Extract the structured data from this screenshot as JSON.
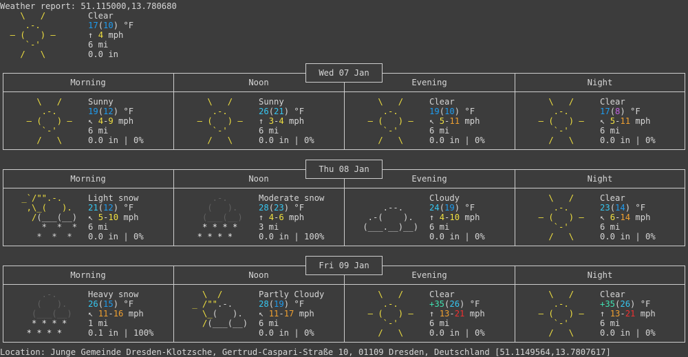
{
  "header": {
    "title": "Weather report: 51.115000,13.780680"
  },
  "current": {
    "condition": "Clear",
    "temp": "17",
    "feels": "10",
    "temp_unit": "°F",
    "wind_arrow": "↑",
    "wind": "4",
    "wind_unit": "mph",
    "visibility": "6 mi",
    "precip": "0.0 in"
  },
  "period_labels": [
    "Morning",
    "Noon",
    "Evening",
    "Night"
  ],
  "days": [
    {
      "date": "Wed 07 Jan",
      "periods": [
        {
          "art": "sunny",
          "condition": "Sunny",
          "temp": "19",
          "feels": "12",
          "wind_arrow": "↖",
          "wind": "4-9",
          "visibility": "6 mi",
          "precip": "0.0 in | 0%"
        },
        {
          "art": "sunny",
          "condition": "Sunny",
          "temp": "26",
          "feels": "21",
          "wind_arrow": "↑",
          "wind": "3-4",
          "visibility": "6 mi",
          "precip": "0.0 in | 0%"
        },
        {
          "art": "sunny",
          "condition": "Clear",
          "temp": "19",
          "feels": "10",
          "wind_arrow": "↖",
          "wind": "5-11",
          "visibility": "6 mi",
          "precip": "0.0 in | 0%"
        },
        {
          "art": "sunny",
          "condition": "Clear",
          "temp": "17",
          "feels": "8",
          "wind_arrow": "↖",
          "wind": "5-11",
          "visibility": "6 mi",
          "precip": "0.0 in | 0%"
        }
      ]
    },
    {
      "date": "Thu 08 Jan",
      "periods": [
        {
          "art": "lightsnow",
          "condition": "Light snow",
          "temp": "21",
          "feels": "12",
          "wind_arrow": "↖",
          "wind": "5-10",
          "visibility": "6 mi",
          "precip": "0.0 in | 0%"
        },
        {
          "art": "modsnow",
          "condition": "Moderate snow",
          "temp": "28",
          "feels": "23",
          "wind_arrow": "↑",
          "wind": "4-6",
          "visibility": "3 mi",
          "precip": "0.0 in | 100%"
        },
        {
          "art": "cloudy",
          "condition": "Cloudy",
          "temp": "24",
          "feels": "19",
          "wind_arrow": "↑",
          "wind": "4-10",
          "visibility": "6 mi",
          "precip": "0.0 in | 0%"
        },
        {
          "art": "sunny",
          "condition": "Clear",
          "temp": "23",
          "feels": "14",
          "wind_arrow": "↖",
          "wind": "6-14",
          "visibility": "6 mi",
          "precip": "0.0 in | 0%"
        }
      ]
    },
    {
      "date": "Fri 09 Jan",
      "periods": [
        {
          "art": "heavysnow",
          "condition": "Heavy snow",
          "temp": "26",
          "feels": "15",
          "wind_arrow": "↖",
          "wind": "11-16",
          "visibility": "1 mi",
          "precip": "0.1 in | 100%"
        },
        {
          "art": "partly",
          "condition": "Partly Cloudy",
          "temp": "28",
          "feels": "19",
          "wind_arrow": "↖",
          "wind": "11-17",
          "visibility": "6 mi",
          "precip": "0.0 in | 0%"
        },
        {
          "art": "sunny",
          "condition": "Clear",
          "temp": "+35",
          "feels": "26",
          "wind_arrow": "↑",
          "wind": "13-21",
          "visibility": "6 mi",
          "precip": "0.0 in | 0%"
        },
        {
          "art": "sunny",
          "condition": "Clear",
          "temp": "+35",
          "feels": "26",
          "wind_arrow": "↑",
          "wind": "13-21",
          "visibility": "6 mi",
          "precip": "0.0 in | 0%"
        }
      ]
    }
  ],
  "units": {
    "temp": "°F",
    "wind": "mph"
  },
  "footer": {
    "location": "Location: Junge Gemeinde Dresden-Klotzsche, Gertrud-Caspari-Straße 10, 01109 Dresden, Deutschland [51.1149564,13.7807617]"
  },
  "colors": {
    "background": "#3c3c3c",
    "text": "#d6d6d6",
    "sun": "#f0e040",
    "temp_blue": "#1e9cf0",
    "temp_cyan": "#36c6f0",
    "temp_purple": "#c060e0",
    "temp_green": "#40e0b0",
    "wind_yellow": "#f0e040",
    "wind_orange": "#f0a030",
    "wind_red": "#f03030",
    "cloud_grey": "#606060",
    "snow_white": "#e8e8e8"
  }
}
